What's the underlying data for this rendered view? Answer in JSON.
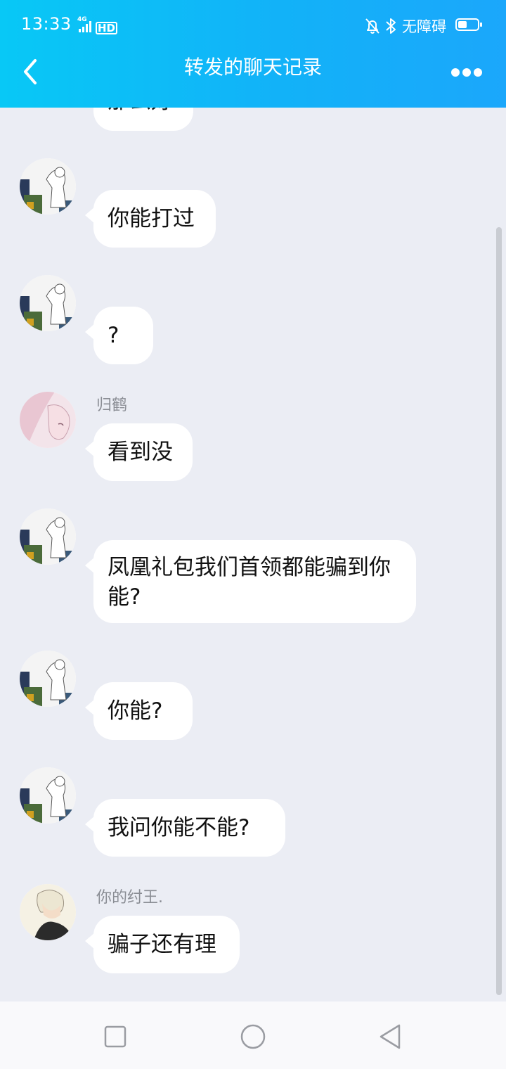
{
  "status_bar": {
    "time": "13:33",
    "network": "4G",
    "hd": "HD",
    "accessibility": "无障碍",
    "icons": [
      "bell-muted-icon",
      "bluetooth-icon",
      "battery-icon"
    ]
  },
  "header": {
    "title": "转发的聊天记录",
    "back_icon": "chevron-left-icon",
    "more_icon": "more-dots-icon"
  },
  "messages": [
    {
      "sender": "",
      "text": "那么好",
      "avatar": "sketch-avatar"
    },
    {
      "sender": "",
      "text": "你能打过",
      "avatar": "sketch-avatar"
    },
    {
      "sender": "",
      "text": "?",
      "avatar": "sketch-avatar"
    },
    {
      "sender": "归鹤",
      "text": "看到没",
      "avatar": "pink-anime-avatar"
    },
    {
      "sender": "",
      "text": "凤凰礼包我们首领都能骗到你能?",
      "avatar": "sketch-avatar"
    },
    {
      "sender": "",
      "text": "你能?",
      "avatar": "sketch-avatar"
    },
    {
      "sender": "",
      "text": "我问你能不能?",
      "avatar": "sketch-avatar"
    },
    {
      "sender": "你的纣王.",
      "text": "骗子还有理",
      "avatar": "anime-boy-avatar"
    }
  ],
  "colors": {
    "header_gradient": [
      "#08c8f6",
      "#1ba7fb"
    ],
    "chat_background": "#ebedf4",
    "bubble": "#ffffff",
    "sender_name": "#8a8d94"
  },
  "system_nav": {
    "icons": [
      "recent-apps-icon",
      "home-icon",
      "back-triangle-icon"
    ]
  }
}
